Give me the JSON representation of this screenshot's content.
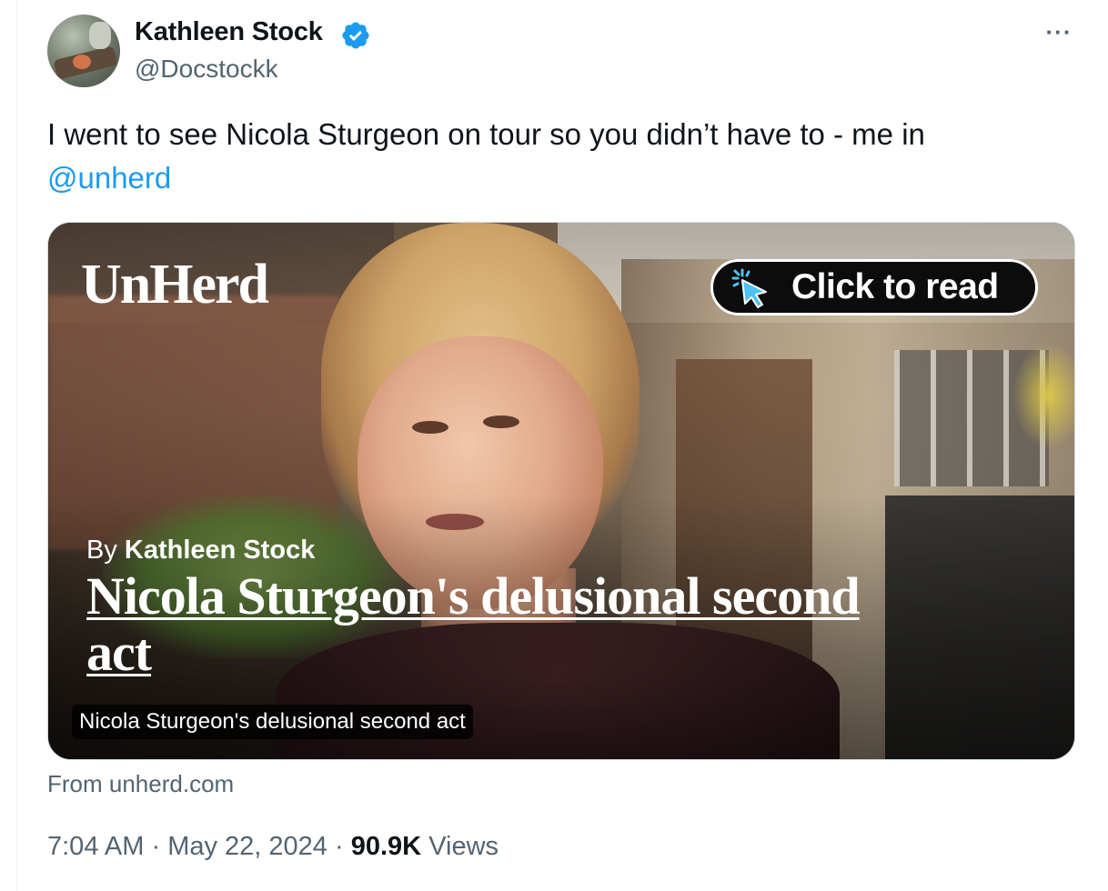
{
  "author": {
    "display_name": "Kathleen Stock",
    "handle": "@Docstockk",
    "verified_icon": "verified-badge-icon",
    "verified_color": "#1d9bf0"
  },
  "menu": {
    "more_label": "···"
  },
  "tweet": {
    "text": "I went to see Nicola Sturgeon on tour so you didn’t have to - me in",
    "mention": "@unherd",
    "mention_color": "#1d9bf0"
  },
  "card": {
    "logo": "UnHerd",
    "cta_label": "Click to read",
    "cta_icon": "cursor-click-icon",
    "byline_prefix": "By",
    "byline_author": "Kathleen Stock",
    "headline": "Nicola Sturgeon's delusional second act",
    "caption": "Nicola Sturgeon's delusional second act",
    "source": "From unherd.com"
  },
  "meta": {
    "time": "7:04 AM",
    "separator": "·",
    "date": "May 22, 2024",
    "views_count": "90.9K",
    "views_label": "Views"
  }
}
